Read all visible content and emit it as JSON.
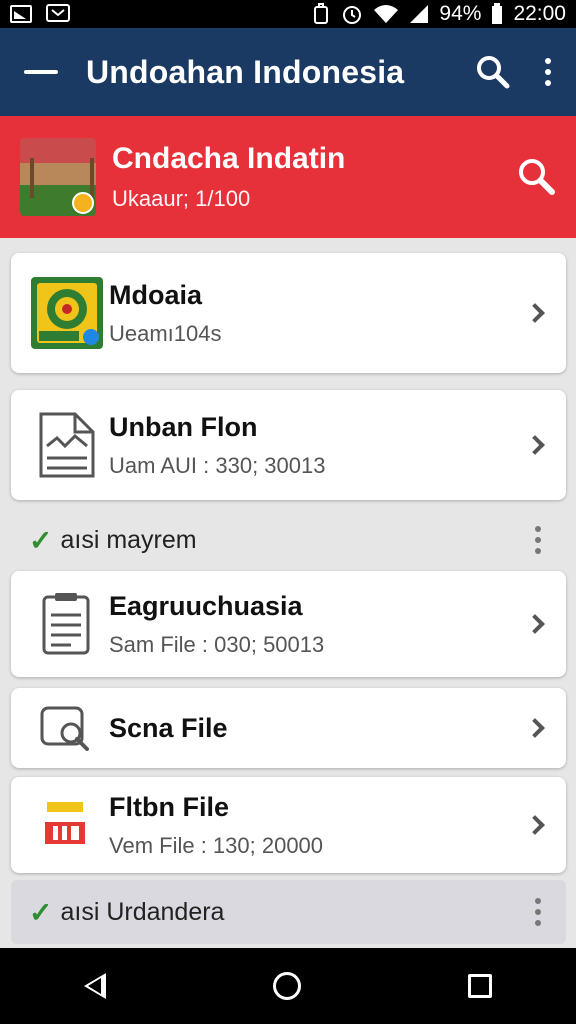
{
  "status_bar": {
    "battery": "94%",
    "time": "22:00",
    "icons": [
      "image-icon",
      "message-icon",
      "sync-icon",
      "alarm-icon",
      "wifi-icon",
      "signal-icon",
      "battery-icon"
    ]
  },
  "app_bar": {
    "title": "Undoahan Indonesia",
    "icons": [
      "menu-icon",
      "search-icon",
      "overflow-menu-icon"
    ]
  },
  "banner": {
    "title": "Cndacha Indatin",
    "subtitle": "Ukaaur; 1/100",
    "color": "#e6313b"
  },
  "items": [
    {
      "title": "Mdoaia",
      "subtitle": "Ueamı104s",
      "icon": "app-badge-icon"
    },
    {
      "title": "Unban Flon",
      "subtitle": "Uam AUI : 330; 30013",
      "icon": "document-chart-icon"
    },
    {
      "title": "Eagruuchuasia",
      "subtitle": "Sam File : 030; 50013",
      "icon": "clipboard-icon"
    },
    {
      "title": "Scna File",
      "subtitle": "",
      "icon": "scan-search-icon"
    },
    {
      "title": "Fltbn File",
      "subtitle": "Vem File : 130; 20000",
      "icon": "pdf-icon"
    }
  ],
  "sections": [
    {
      "label": "aısi mayrem"
    },
    {
      "label": "aısi Urdandera"
    }
  ],
  "colors": {
    "app_bar": "#1b3a63",
    "accent_red": "#e6313b",
    "check_green": "#2f8f2f"
  }
}
